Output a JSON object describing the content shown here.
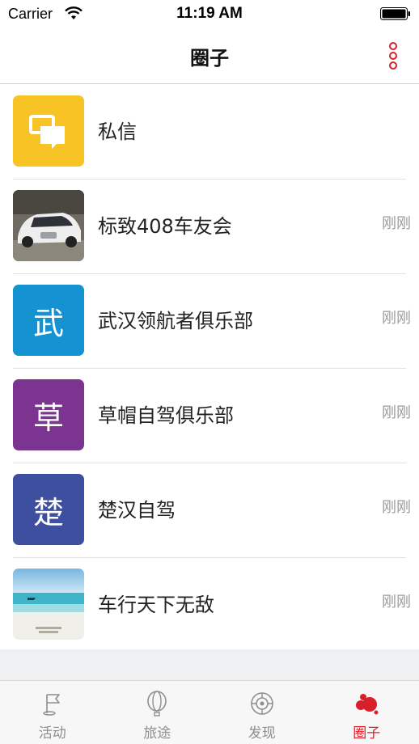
{
  "status_bar": {
    "carrier": "Carrier",
    "time": "11:19 AM"
  },
  "nav": {
    "title": "圈子",
    "more_icon": "more-vertical-icon",
    "accent_color": "#d8202a"
  },
  "chats": [
    {
      "title": "私信",
      "time": "",
      "avatar_type": "message-icon",
      "avatar_color": "#f7c325"
    },
    {
      "title": "标致408车友会",
      "time": "刚刚",
      "avatar_type": "car-photo"
    },
    {
      "title": "武汉领航者俱乐部",
      "time": "刚刚",
      "avatar_letter": "武",
      "avatar_color": "#1492d2"
    },
    {
      "title": "草帽自驾俱乐部",
      "time": "刚刚",
      "avatar_letter": "草",
      "avatar_color": "#7b3591"
    },
    {
      "title": "楚汉自驾",
      "time": "刚刚",
      "avatar_letter": "楚",
      "avatar_color": "#3f4f9f"
    },
    {
      "title": "车行天下无敌",
      "time": "刚刚",
      "avatar_type": "beach-photo"
    }
  ],
  "tabs": [
    {
      "label": "活动",
      "icon": "flag-icon",
      "active": false
    },
    {
      "label": "旅途",
      "icon": "balloon-icon",
      "active": false
    },
    {
      "label": "发现",
      "icon": "compass-icon",
      "active": false
    },
    {
      "label": "圈子",
      "icon": "circle-group-icon",
      "active": true
    }
  ]
}
